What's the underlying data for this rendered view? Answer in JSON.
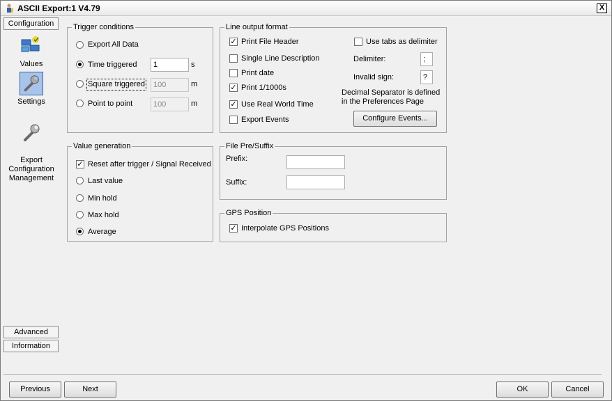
{
  "window": {
    "title": "ASCII Export:1 V4.79",
    "close_glyph": "X"
  },
  "sidebar": {
    "top_tab": "Configuration",
    "items": [
      {
        "label": "Values",
        "icon": "values-icon"
      },
      {
        "label": "Settings",
        "icon": "wrench-icon"
      },
      {
        "label": "Export\nConfiguration\nManagement",
        "icon": "wrench-icon"
      }
    ],
    "bottom_tabs": [
      "Advanced",
      "Information"
    ]
  },
  "trigger": {
    "legend": "Trigger conditions",
    "export_all": "Export All Data",
    "time_triggered": "Time triggered",
    "time_value": "1",
    "time_unit": "s",
    "square_triggered": "Square triggered",
    "square_value": "100",
    "square_unit": "m",
    "point_to_point": "Point to point",
    "point_value": "100",
    "point_unit": "m",
    "selected": "time_triggered"
  },
  "value_gen": {
    "legend": "Value generation",
    "reset": "Reset after trigger / Signal Received",
    "reset_checked": true,
    "last_value": "Last value",
    "min_hold": "Min hold",
    "max_hold": "Max hold",
    "average": "Average",
    "selected": "average"
  },
  "line_output": {
    "legend": "Line output format",
    "print_file_header": "Print File Header",
    "single_line_description": "Single Line Description",
    "print_date": "Print date",
    "print_1000s": "Print 1/1000s",
    "use_real_world_time": "Use Real World Time",
    "export_events": "Export Events",
    "use_tabs": "Use tabs as delimiter",
    "delimiter_label": "Delimiter:",
    "delimiter_value": ";",
    "invalid_label": "Invalid sign:",
    "invalid_value": "?",
    "decimal_note_1": "Decimal Separator is defined",
    "decimal_note_2": "in the Preferences Page",
    "configure_events": "Configure Events...",
    "check_mark": "✓"
  },
  "file_prefix": {
    "legend": "File Pre/Suffix",
    "prefix_label": "Prefix:",
    "prefix_value": "",
    "suffix_label": "Suffix:",
    "suffix_value": ""
  },
  "gps": {
    "legend": "GPS Position",
    "interpolate": "Interpolate GPS Positions"
  },
  "footer": {
    "previous": "Previous",
    "next": "Next",
    "ok": "OK",
    "cancel": "Cancel"
  }
}
